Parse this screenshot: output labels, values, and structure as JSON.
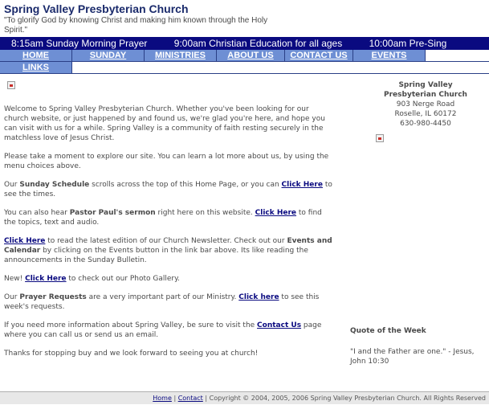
{
  "header": {
    "title": "Spring Valley Presbyterian Church",
    "tagline": "\"To glorify God by knowing Christ and making him known through the Holy Spirit.\""
  },
  "ticker": {
    "items": [
      "8:15am Sunday Morning Prayer",
      "9:00am Christian Education for all ages",
      "10:00am Pre-Sing"
    ]
  },
  "nav": {
    "items": [
      "HOME",
      "SUNDAY",
      "MINISTRIES",
      "ABOUT US",
      "CONTACT US",
      "EVENTS",
      "LINKS"
    ]
  },
  "main": {
    "p1": "Welcome to Spring Valley Presbyterian Church. Whether you've been looking for our church website, or just happened by and found us, we're glad you're here, and hope you can visit with us for a while. Spring Valley is a community of faith resting securely in the matchless love of Jesus Christ.",
    "p2": "Please take a moment to explore our site.  You can learn a lot more about us, by using the menu choices above.",
    "p3": {
      "pre": "Our ",
      "bold": "Sunday Schedule",
      "mid": " scrolls across the top of this Home Page, or you can ",
      "link": "Click Here",
      "post": " to see the times."
    },
    "p4": {
      "pre": "You can also hear ",
      "bold": "Pastor Paul's sermon",
      "mid": " right here on this website.  ",
      "link": "Click Here",
      "post": " to find the topics, text and audio."
    },
    "p5": {
      "link": "Click Here",
      "mid": " to read the latest edition of our Church Newsletter.  Check out our ",
      "bold": "Events and Calendar",
      "post": " by clicking on the Events button in the link bar above.  Its like reading the announcements in the Sunday Bulletin."
    },
    "p6": {
      "pre": "New!  ",
      "link": "Click Here",
      "post": " to check out our Photo Gallery."
    },
    "p7": {
      "pre": "Our ",
      "bold": "Prayer Requests",
      "mid": " are a very important part of our Ministry.  ",
      "link": "Click here",
      "post": " to see this week's requests."
    },
    "p8": {
      "pre": "If you need more information about Spring Valley, be sure to visit the ",
      "link": "Contact Us",
      "post": " page where you can call us or send us an email."
    },
    "p9": "Thanks for stopping buy and we look forward to seeing you at church!"
  },
  "sidebar": {
    "name_line1": "Spring Valley",
    "name_line2": "Presbyterian Church",
    "address": "903 Nerge Road",
    "city": "Roselle, IL  60172",
    "phone": "630-980-4450"
  },
  "quote": {
    "heading": "Quote of the Week",
    "text": "\"I and the Father are one.\" - Jesus, John 10:30"
  },
  "footer": {
    "home": "Home",
    "contact": "Contact",
    "copyright": "Copyright © 2004, 2005, 2006 Spring Valley Presbyterian Church. All Rights Reserved"
  },
  "colors": {
    "title": "#1a2a6b",
    "ticker_bg": "#0a0a80",
    "nav_bg": "#6e8fd4",
    "link": "#0a0a80"
  },
  "icons": [
    "broken-image-icon"
  ]
}
